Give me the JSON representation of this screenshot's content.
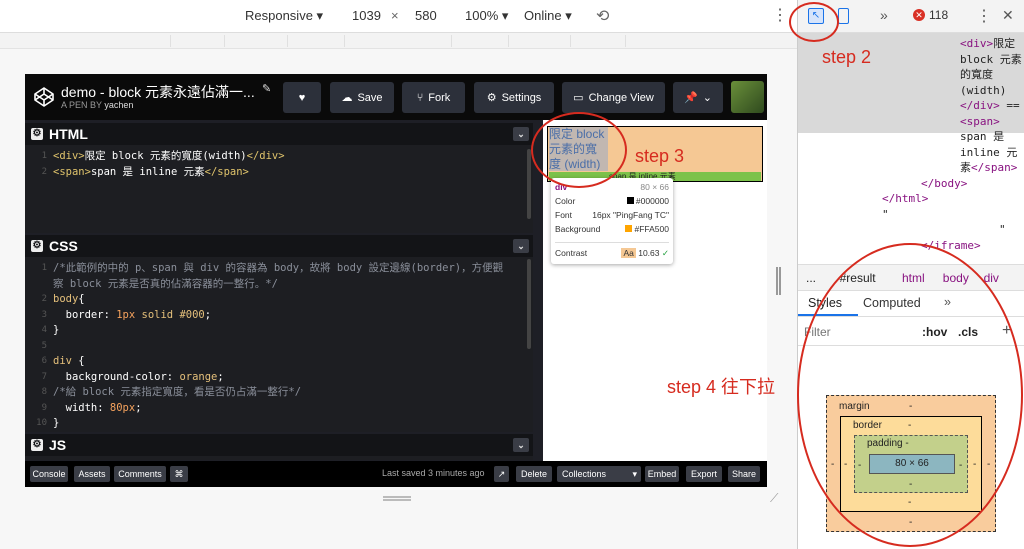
{
  "device_toolbar": {
    "mode": "Responsive",
    "width": "1039",
    "x": "×",
    "height": "580",
    "zoom": "100%",
    "network": "Online"
  },
  "devtools_top": {
    "more": "»",
    "error_count": "118"
  },
  "codepen": {
    "title": "demo - block 元素永遠佔滿一...",
    "byline_prefix": "A PEN BY",
    "author": "yachen",
    "buttons": {
      "save": "Save",
      "fork": "Fork",
      "settings": "Settings",
      "change_view": "Change View"
    },
    "html_panel": {
      "title": "HTML",
      "lines": [
        {
          "n": "1",
          "parts": [
            {
              "c": "tag",
              "t": "<div>"
            },
            {
              "c": "val",
              "t": "限定 block 元素的寬度(width)"
            },
            {
              "c": "tag",
              "t": "</div>"
            }
          ]
        },
        {
          "n": "2",
          "parts": [
            {
              "c": "tag",
              "t": "<span>"
            },
            {
              "c": "val",
              "t": "span 是 inline 元素"
            },
            {
              "c": "tag",
              "t": "</span>"
            }
          ]
        }
      ]
    },
    "css_panel": {
      "title": "CSS",
      "lines": [
        {
          "n": "1",
          "parts": [
            {
              "c": "cm",
              "t": "/*此範例的中的 p、span 與 div 的容器為 body，故將 body 設定邊線(border)，方便觀"
            }
          ]
        },
        {
          "n": "",
          "parts": [
            {
              "c": "cm",
              "t": "察 block 元素是否真的佔滿容器的一整行。*/"
            }
          ]
        },
        {
          "n": "2",
          "parts": [
            {
              "c": "kw",
              "t": "body"
            },
            {
              "c": "val",
              "t": "{"
            }
          ]
        },
        {
          "n": "3",
          "parts": [
            {
              "c": "val",
              "t": "  border: "
            },
            {
              "c": "num",
              "t": "1px"
            },
            {
              "c": "kw",
              "t": " solid #000"
            },
            {
              "c": "val",
              "t": ";"
            }
          ]
        },
        {
          "n": "4",
          "parts": [
            {
              "c": "val",
              "t": "}"
            }
          ]
        },
        {
          "n": "5",
          "parts": [
            {
              "c": "val",
              "t": ""
            }
          ]
        },
        {
          "n": "6",
          "parts": [
            {
              "c": "kw",
              "t": "div"
            },
            {
              "c": "val",
              "t": " {"
            }
          ]
        },
        {
          "n": "7",
          "parts": [
            {
              "c": "val",
              "t": "  background-color: "
            },
            {
              "c": "kw",
              "t": "orange"
            },
            {
              "c": "val",
              "t": ";"
            }
          ]
        },
        {
          "n": "8",
          "parts": [
            {
              "c": "cm",
              "t": "/*給 block 元素指定寬度，看是否仍占滿一整行*/"
            }
          ]
        },
        {
          "n": "9",
          "parts": [
            {
              "c": "val",
              "t": "  width: "
            },
            {
              "c": "num",
              "t": "80px"
            },
            {
              "c": "val",
              "t": ";"
            }
          ]
        },
        {
          "n": "10",
          "parts": [
            {
              "c": "val",
              "t": "}"
            }
          ]
        }
      ]
    },
    "js_panel": {
      "title": "JS"
    },
    "footer": {
      "console": "Console",
      "assets": "Assets",
      "comments": "Comments",
      "shortcut": "⌘",
      "last_saved": "Last saved 3 minutes ago",
      "delete": "Delete",
      "collections": "Collections",
      "embed": "Embed",
      "export": "Export",
      "share": "Share"
    },
    "result": {
      "div_text": "限定 block 元素的寬度 (width)",
      "span_peek": "span 是 inline 元素"
    },
    "tooltip": {
      "tag": "div",
      "size": "80 × 66",
      "color_label": "Color",
      "color_val": "#000000",
      "font_label": "Font",
      "font_val": "16px \"PingFang TC\"",
      "bg_label": "Background",
      "bg_val": "#FFA500",
      "contrast_label": "Contrast",
      "aa": "Aa",
      "contrast_val": "10.63"
    }
  },
  "devtools": {
    "dom_lines": [
      {
        "i": 3,
        "parts": [
          {
            "c": "dtag",
            "t": "<div>"
          },
          {
            "c": "",
            "t": "限定"
          }
        ]
      },
      {
        "i": 3,
        "parts": [
          {
            "c": "",
            "t": "block 元素"
          }
        ]
      },
      {
        "i": 3,
        "parts": [
          {
            "c": "",
            "t": "的寬度"
          }
        ]
      },
      {
        "i": 3,
        "parts": [
          {
            "c": "",
            "t": "(width)"
          }
        ]
      },
      {
        "i": 3,
        "parts": [
          {
            "c": "dtag",
            "t": "</div>"
          },
          {
            "c": "",
            "t": " =="
          }
        ]
      },
      {
        "i": 3,
        "parts": [
          {
            "c": "dtag",
            "t": "<span>"
          }
        ]
      },
      {
        "i": 3,
        "parts": [
          {
            "c": "",
            "t": "span 是"
          }
        ]
      },
      {
        "i": 3,
        "parts": [
          {
            "c": "",
            "t": "inline 元"
          }
        ]
      },
      {
        "i": 3,
        "parts": [
          {
            "c": "",
            "t": "素"
          },
          {
            "c": "dtag",
            "t": "</span>"
          }
        ]
      },
      {
        "i": 2,
        "parts": [
          {
            "c": "dtag",
            "t": "</body>"
          }
        ]
      },
      {
        "i": 1,
        "parts": [
          {
            "c": "dtag",
            "t": "</html>"
          }
        ]
      },
      {
        "i": 1,
        "parts": [
          {
            "c": "",
            "t": "\""
          }
        ]
      },
      {
        "i": 4,
        "parts": [
          {
            "c": "",
            "t": "\""
          }
        ]
      },
      {
        "i": 2,
        "parts": [
          {
            "c": "dtag",
            "t": "</iframe>"
          }
        ]
      }
    ],
    "crumbs": [
      "...",
      "#result",
      "html",
      "body",
      "div"
    ],
    "tabs": {
      "styles": "Styles",
      "computed": "Computed",
      "more": "»"
    },
    "filter": {
      "placeholder": "Filter",
      "hov": ":hov",
      "cls": ".cls",
      "plus": "+"
    },
    "boxmodel": {
      "margin": "margin",
      "border": "border",
      "padding": "padding",
      "dash": "-",
      "content": "80 × 66"
    }
  },
  "annotations": {
    "step2": "step 2",
    "step3": "step 3",
    "step4": "step 4 往下拉"
  }
}
